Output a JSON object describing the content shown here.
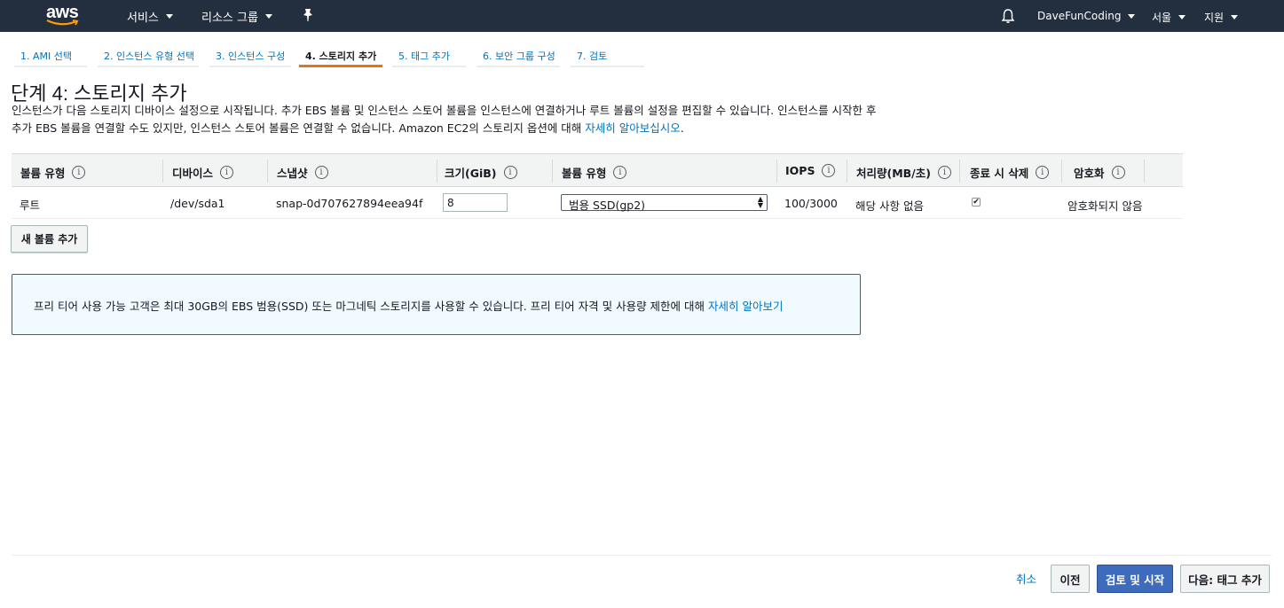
{
  "nav": {
    "logo": "aws",
    "services": "서비스",
    "resource_groups": "리소스 그룹",
    "pin_icon": "pin-icon",
    "bell_icon": "bell-icon",
    "account": "DaveFunCoding",
    "region": "서울",
    "support": "지원"
  },
  "wizard": {
    "tabs": [
      {
        "label": "1. AMI 선택"
      },
      {
        "label": "2. 인스턴스 유형 선택"
      },
      {
        "label": "3. 인스턴스 구성"
      },
      {
        "label": "4. 스토리지 추가"
      },
      {
        "label": "5. 태그 추가"
      },
      {
        "label": "6. 보안 그룹 구성"
      },
      {
        "label": "7. 검토"
      }
    ],
    "active_tab": 3
  },
  "page": {
    "title": "단계 4: 스토리지 추가",
    "description": "인스턴스가 다음 스토리지 디바이스 설정으로 시작됩니다. 추가 EBS 볼륨 및 인스턴스 스토어 볼륨을 인스턴스에 연결하거나 루트 볼륨의 설정을 편집할 수 있습니다. 인스턴스를 시작한 후 추가 EBS 볼륨을 연결할 수도 있지만, 인스턴스 스토어 볼륨은 연결할 수 없습니다. Amazon EC2의 스토리지 옵션에 대해",
    "description_link": "자세히 알아보십시오",
    "description_end": "."
  },
  "table": {
    "headers": [
      "볼륨 유형",
      "디바이스",
      "스냅샷",
      "크기(GiB)",
      "볼륨 유형",
      "IOPS",
      "처리량(MB/초)",
      "종료 시 삭제",
      "암호화"
    ],
    "rows": [
      {
        "volume_type": "루트",
        "device": "/dev/sda1",
        "snapshot": "snap-0d707627894eea94f",
        "size": "8",
        "volume_kind": "범용 SSD(gp2)",
        "iops": "100/3000",
        "throughput": "해당 사항 없음",
        "delete_on_termination": true,
        "encryption": "암호화되지 않음"
      }
    ]
  },
  "add_volume_button": "새 볼륨 추가",
  "notice": {
    "text": "프리 티어 사용 가능 고객은 최대 30GB의 EBS 범용(SSD) 또는 마그네틱 스토리지를 사용할 수 있습니다. 프리 티어 자격 및 사용량 제한에 대해",
    "link": "자세히 알아보기"
  },
  "footer": {
    "cancel": "취소",
    "previous": "이전",
    "review_launch": "검토 및 시작",
    "next": "다음: 태그 추가"
  },
  "colors": {
    "nav_bg": "#232f3e",
    "active_tab": "#ec7211",
    "link": "#0073bb",
    "primary_button": "#3f6bbd"
  }
}
